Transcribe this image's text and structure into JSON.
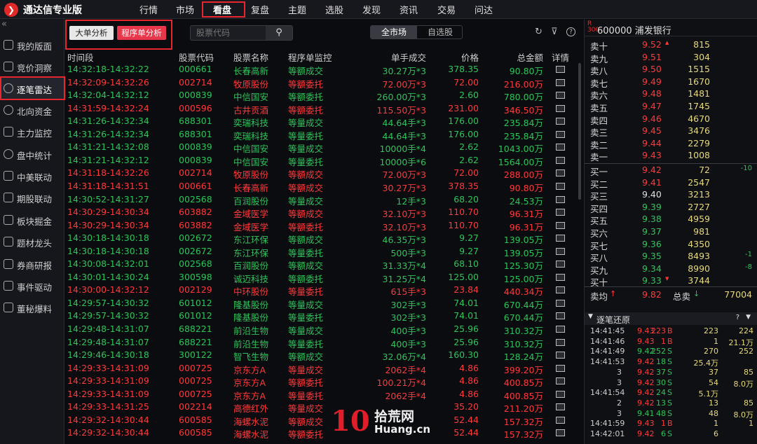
{
  "app": {
    "title": "通达信专业版",
    "logo": "tdx-logo-icon"
  },
  "topnav": [
    "行情",
    "市场",
    "看盘",
    "复盘",
    "主题",
    "选股",
    "发现",
    "资讯",
    "交易",
    "问达"
  ],
  "sidebar": {
    "collapse": "«",
    "items": [
      {
        "label": "我的版面",
        "icon": "layout-icon"
      },
      {
        "label": "竞价洞察",
        "icon": "bid-icon"
      },
      {
        "label": "逐笔雷达",
        "icon": "radar-icon"
      },
      {
        "label": "北向资金",
        "icon": "north-fund-icon"
      },
      {
        "label": "主力监控",
        "icon": "monitor-icon"
      },
      {
        "label": "盘中统计",
        "icon": "stats-icon"
      },
      {
        "label": "中美联动",
        "icon": "link-icon"
      },
      {
        "label": "期股联动",
        "icon": "futures-icon"
      },
      {
        "label": "板块掘金",
        "icon": "sector-icon"
      },
      {
        "label": "题材龙头",
        "icon": "trophy-icon"
      },
      {
        "label": "券商研报",
        "icon": "report-icon"
      },
      {
        "label": "事件驱动",
        "icon": "event-icon"
      },
      {
        "label": "董秘爆料",
        "icon": "news-icon"
      }
    ]
  },
  "toolbar": {
    "btn_big": "大单分析",
    "btn_prog": "程序单分析",
    "search_placeholder": "股票代码",
    "seg_all": "全市场",
    "seg_self": "自选股",
    "icons": [
      "refresh-icon",
      "filter-icon",
      "help-icon"
    ]
  },
  "table": {
    "headers": [
      "时间段",
      "股票代码",
      "股票名称",
      "程序单监控",
      "单手成交",
      "价格",
      "总金额",
      "详情"
    ],
    "rows": [
      {
        "time": "14:32:18-14:32:22",
        "code": "000661",
        "name": "长春高新",
        "mon": "等额成交",
        "vol": "30.27万*3",
        "price": "378.35",
        "amt": "90.80万",
        "c": "green"
      },
      {
        "time": "14:32:09-14:32:26",
        "code": "002714",
        "name": "牧原股份",
        "mon": "等额委托",
        "vol": "72.00万*3",
        "price": "72.00",
        "amt": "216.00万",
        "c": "red"
      },
      {
        "time": "14:32:04-14:32:12",
        "code": "000839",
        "name": "中信国安",
        "mon": "等额委托",
        "vol": "260.00万*3",
        "price": "2.60",
        "amt": "780.00万",
        "c": "green"
      },
      {
        "time": "14:31:59-14:32:24",
        "code": "000596",
        "name": "古井贡酒",
        "mon": "等额委托",
        "vol": "115.50万*3",
        "price": "231.00",
        "amt": "346.50万",
        "c": "red"
      },
      {
        "time": "14:31:26-14:32:34",
        "code": "688301",
        "name": "奕瑞科技",
        "mon": "等量成交",
        "vol": "44.64手*3",
        "price": "176.00",
        "amt": "235.84万",
        "c": "green"
      },
      {
        "time": "14:31:26-14:32:34",
        "code": "688301",
        "name": "奕瑞科技",
        "mon": "等量委托",
        "vol": "44.64手*3",
        "price": "176.00",
        "amt": "235.84万",
        "c": "green"
      },
      {
        "time": "14:31:21-14:32:08",
        "code": "000839",
        "name": "中信国安",
        "mon": "等量成交",
        "vol": "10000手*4",
        "price": "2.62",
        "amt": "1043.00万",
        "c": "green"
      },
      {
        "time": "14:31:21-14:32:12",
        "code": "000839",
        "name": "中信国安",
        "mon": "等量委托",
        "vol": "10000手*6",
        "price": "2.62",
        "amt": "1564.00万",
        "c": "green"
      },
      {
        "time": "14:31:18-14:32:26",
        "code": "002714",
        "name": "牧原股份",
        "mon": "等额成交",
        "vol": "72.00万*3",
        "price": "72.00",
        "amt": "288.00万",
        "c": "red"
      },
      {
        "time": "14:31:18-14:31:51",
        "code": "000661",
        "name": "长春高新",
        "mon": "等额成交",
        "vol": "30.27万*3",
        "price": "378.35",
        "amt": "90.80万",
        "c": "red"
      },
      {
        "time": "14:30:52-14:31:27",
        "code": "002568",
        "name": "百润股份",
        "mon": "等量成交",
        "vol": "12手*3",
        "price": "68.20",
        "amt": "24.53万",
        "c": "green"
      },
      {
        "time": "14:30:29-14:30:34",
        "code": "603882",
        "name": "金域医学",
        "mon": "等额成交",
        "vol": "32.10万*3",
        "price": "110.70",
        "amt": "96.31万",
        "c": "red"
      },
      {
        "time": "14:30:29-14:30:34",
        "code": "603882",
        "name": "金域医学",
        "mon": "等额委托",
        "vol": "32.10万*3",
        "price": "110.70",
        "amt": "96.31万",
        "c": "red"
      },
      {
        "time": "14:30:18-14:30:18",
        "code": "002672",
        "name": "东江环保",
        "mon": "等额成交",
        "vol": "46.35万*3",
        "price": "9.27",
        "amt": "139.05万",
        "c": "green"
      },
      {
        "time": "14:30:18-14:30:18",
        "code": "002672",
        "name": "东江环保",
        "mon": "等量委托",
        "vol": "500手*3",
        "price": "9.27",
        "amt": "139.05万",
        "c": "green"
      },
      {
        "time": "14:30:08-14:32:01",
        "code": "002568",
        "name": "百润股份",
        "mon": "等额成交",
        "vol": "31.33万*4",
        "price": "68.10",
        "amt": "125.30万",
        "c": "green"
      },
      {
        "time": "14:30:01-14:30:24",
        "code": "300598",
        "name": "诚迈科技",
        "mon": "等额委托",
        "vol": "31.25万*4",
        "price": "125.00",
        "amt": "125.00万",
        "c": "green"
      },
      {
        "time": "14:30:00-14:32:12",
        "code": "002129",
        "name": "中环股份",
        "mon": "等量委托",
        "vol": "615手*3",
        "price": "23.84",
        "amt": "440.34万",
        "c": "red"
      },
      {
        "time": "14:29:57-14:30:32",
        "code": "601012",
        "name": "隆基股份",
        "mon": "等量成交",
        "vol": "302手*3",
        "price": "74.01",
        "amt": "670.44万",
        "c": "green"
      },
      {
        "time": "14:29:57-14:30:32",
        "code": "601012",
        "name": "隆基股份",
        "mon": "等量委托",
        "vol": "302手*3",
        "price": "74.01",
        "amt": "670.44万",
        "c": "green"
      },
      {
        "time": "14:29:48-14:31:07",
        "code": "688221",
        "name": "前沿生物",
        "mon": "等量成交",
        "vol": "400手*3",
        "price": "25.96",
        "amt": "310.32万",
        "c": "green"
      },
      {
        "time": "14:29:48-14:31:07",
        "code": "688221",
        "name": "前沿生物",
        "mon": "等量委托",
        "vol": "400手*3",
        "price": "25.96",
        "amt": "310.32万",
        "c": "green"
      },
      {
        "time": "14:29:46-14:30:18",
        "code": "300122",
        "name": "智飞生物",
        "mon": "等额成交",
        "vol": "32.06万*4",
        "price": "160.30",
        "amt": "128.24万",
        "c": "green"
      },
      {
        "time": "14:29:33-14:31:09",
        "code": "000725",
        "name": "京东方A",
        "mon": "等量成交",
        "vol": "2062手*4",
        "price": "4.86",
        "amt": "399.20万",
        "c": "red"
      },
      {
        "time": "14:29:33-14:31:09",
        "code": "000725",
        "name": "京东方A",
        "mon": "等额委托",
        "vol": "100.21万*4",
        "price": "4.86",
        "amt": "400.85万",
        "c": "red"
      },
      {
        "time": "14:29:33-14:31:09",
        "code": "000725",
        "name": "京东方A",
        "mon": "等量委托",
        "vol": "2062手*4",
        "price": "4.86",
        "amt": "400.85万",
        "c": "red"
      },
      {
        "time": "14:29:33-14:31:25",
        "code": "002214",
        "name": "高德红外",
        "mon": "等量成交",
        "vol": "",
        "price": "35.20",
        "amt": "211.20万",
        "c": "red"
      },
      {
        "time": "14:29:32-14:30:44",
        "code": "600585",
        "name": "海螺水泥",
        "mon": "等额成交",
        "vol": "",
        "price": "52.44",
        "amt": "157.32万",
        "c": "red"
      },
      {
        "time": "14:29:32-14:30:44",
        "code": "600585",
        "name": "海螺水泥",
        "mon": "等额委托",
        "vol": "",
        "price": "52.44",
        "amt": "157.32万",
        "c": "red"
      }
    ]
  },
  "quote": {
    "badge": "R\n300",
    "title": "600000 浦发银行",
    "asks": [
      {
        "l": "卖十",
        "p": "9.52",
        "v": "815",
        "c": "red",
        "ch": "",
        "mk": "▲"
      },
      {
        "l": "卖九",
        "p": "9.51",
        "v": "304",
        "c": "red",
        "ch": ""
      },
      {
        "l": "卖八",
        "p": "9.50",
        "v": "1515",
        "c": "red",
        "ch": ""
      },
      {
        "l": "卖七",
        "p": "9.49",
        "v": "1670",
        "c": "red",
        "ch": ""
      },
      {
        "l": "卖六",
        "p": "9.48",
        "v": "1481",
        "c": "red",
        "ch": ""
      },
      {
        "l": "卖五",
        "p": "9.47",
        "v": "1745",
        "c": "red",
        "ch": ""
      },
      {
        "l": "卖四",
        "p": "9.46",
        "v": "4670",
        "c": "red",
        "ch": ""
      },
      {
        "l": "卖三",
        "p": "9.45",
        "v": "3476",
        "c": "red",
        "ch": ""
      },
      {
        "l": "卖二",
        "p": "9.44",
        "v": "2279",
        "c": "red",
        "ch": ""
      },
      {
        "l": "卖一",
        "p": "9.43",
        "v": "1008",
        "c": "red",
        "ch": ""
      }
    ],
    "bids": [
      {
        "l": "买一",
        "p": "9.42",
        "v": "72",
        "c": "red",
        "ch": "-10"
      },
      {
        "l": "买二",
        "p": "9.41",
        "v": "2547",
        "c": "red",
        "ch": ""
      },
      {
        "l": "买三",
        "p": "9.40",
        "v": "3213",
        "c": "white",
        "ch": ""
      },
      {
        "l": "买四",
        "p": "9.39",
        "v": "2727",
        "c": "green",
        "ch": ""
      },
      {
        "l": "买五",
        "p": "9.38",
        "v": "4959",
        "c": "green",
        "ch": ""
      },
      {
        "l": "买六",
        "p": "9.37",
        "v": "981",
        "c": "green",
        "ch": ""
      },
      {
        "l": "买七",
        "p": "9.36",
        "v": "4350",
        "c": "green",
        "ch": ""
      },
      {
        "l": "买八",
        "p": "9.35",
        "v": "8493",
        "c": "green",
        "ch": "-1"
      },
      {
        "l": "买九",
        "p": "9.34",
        "v": "8990",
        "c": "green",
        "ch": "-8"
      },
      {
        "l": "买十",
        "p": "9.33",
        "v": "3744",
        "c": "green",
        "ch": "",
        "mk": "▼"
      }
    ],
    "avg_label": "卖均",
    "avg_value": "9.82",
    "total_label": "总卖",
    "total_value": "77004"
  },
  "ticks": {
    "title": "逐笔还原",
    "rows": [
      {
        "t": "14:41:45",
        "p": "9.43",
        "v": "223",
        "b": "B",
        "n1": "223",
        "n2": "224",
        "pc": "red",
        "bc": "red"
      },
      {
        "t": "14:41:46",
        "p": "9.43",
        "v": "1",
        "b": "B",
        "n1": "1",
        "n2": "21.1万",
        "pc": "red",
        "bc": "red"
      },
      {
        "t": "14:41:49",
        "p": "9.42",
        "v": "252",
        "b": "S",
        "n1": "270",
        "n2": "252",
        "pc": "green",
        "bc": "green"
      },
      {
        "t": "14:41:53",
        "p": "9.42",
        "v": "18",
        "b": "S",
        "n1": "25.4万",
        "n2": "",
        "pc": "red",
        "bc": "green"
      },
      {
        "t": "3",
        "p": "9.42",
        "v": "37",
        "b": "S",
        "n1": "37",
        "n2": "85",
        "pc": "red",
        "bc": "green"
      },
      {
        "t": "3",
        "p": "9.42",
        "v": "30",
        "b": "S",
        "n1": "54",
        "n2": "8.0万",
        "pc": "red",
        "bc": "green"
      },
      {
        "t": "14:41:54",
        "p": "9.42",
        "v": "24",
        "b": "S",
        "n1": "5.1万",
        "n2": "",
        "pc": "red",
        "bc": "green"
      },
      {
        "t": "2",
        "p": "9.42",
        "v": "13",
        "b": "S",
        "n1": "13",
        "n2": "85",
        "pc": "red",
        "bc": "green"
      },
      {
        "t": "3",
        "p": "9.41",
        "v": "48",
        "b": "S",
        "n1": "48",
        "n2": "8.0万",
        "pc": "green",
        "bc": "green"
      },
      {
        "t": "14:41:59",
        "p": "9.43",
        "v": "1",
        "b": "B",
        "n1": "1",
        "n2": "1",
        "pc": "red",
        "bc": "red"
      },
      {
        "t": "14:42:01",
        "p": "9.42",
        "v": "6",
        "b": "S",
        "n1": "6",
        "n2": "",
        "pc": "red",
        "bc": "green"
      }
    ]
  },
  "watermark": {
    "num": "10",
    "cn": "拾荒网",
    "en": "Huang.cn"
  }
}
